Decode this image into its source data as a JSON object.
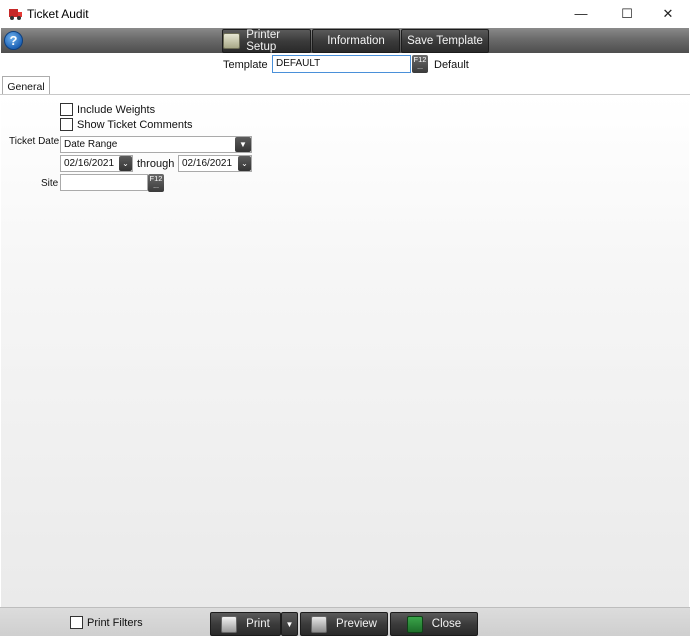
{
  "window": {
    "title": "Ticket Audit",
    "minimize_glyph": "—",
    "maximize_glyph": "☐",
    "close_glyph": "✕"
  },
  "toolbar": {
    "help_glyph": "?",
    "printer_setup_label": "Printer Setup",
    "information_label": "Information",
    "save_template_label": "Save Template"
  },
  "template": {
    "label": "Template",
    "value": "DEFAULT",
    "lookup_key": "F12",
    "lookup_dots": "...",
    "description": "Default"
  },
  "tabs": [
    {
      "label": "General",
      "selected": true
    }
  ],
  "general": {
    "include_weights": {
      "label": "Include Weights",
      "checked": false
    },
    "show_ticket_comments": {
      "label": "Show Ticket Comments",
      "checked": false
    },
    "ticket_date": {
      "label": "Ticket Date",
      "mode": "Date Range",
      "from": "02/16/2021",
      "through_label": "through",
      "to": "02/16/2021"
    },
    "site": {
      "label": "Site",
      "value": "",
      "lookup_key": "F12",
      "lookup_dots": "..."
    }
  },
  "footer": {
    "print_filters": {
      "label": "Print Filters",
      "checked": false
    },
    "print_label": "Print",
    "preview_label": "Preview",
    "close_label": "Close"
  },
  "icons": {
    "dropdown_arrow": "▼",
    "datepicker_arrow": "⌄"
  },
  "colors": {
    "toolbar_dark": "#3b3b3b",
    "input_focus_border": "#4a90d9",
    "help_blue": "#1f63b5",
    "close_green": "#2e8b3c"
  }
}
